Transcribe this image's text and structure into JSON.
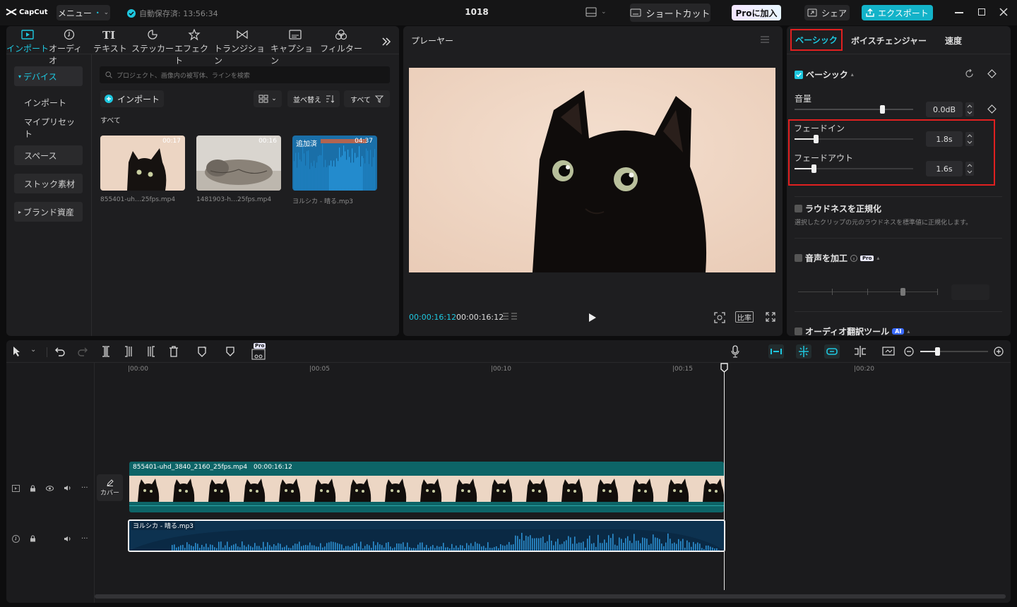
{
  "titlebar": {
    "logo": "CapCut",
    "menu_label": "メニュー",
    "autosave": "自動保存済: 13:56:34",
    "project_name": "1018",
    "shortcut_label": "ショートカット",
    "pro_label": "Proに加入",
    "share_label": "シェア",
    "export_label": "エクスポート"
  },
  "media": {
    "tools": [
      {
        "label": "インポート",
        "icon": "import-icon"
      },
      {
        "label": "オーディオ",
        "icon": "audio-icon"
      },
      {
        "label": "テキスト",
        "icon": "text-icon"
      },
      {
        "label": "ステッカー",
        "icon": "sticker-icon"
      },
      {
        "label": "エフェクト",
        "icon": "effect-icon"
      },
      {
        "label": "トランジション",
        "icon": "transition-icon"
      },
      {
        "label": "キャプション",
        "icon": "caption-icon"
      },
      {
        "label": "フィルター",
        "icon": "filter-icon"
      }
    ],
    "sidebar": [
      "デバイス",
      "インポート",
      "マイプリセット",
      "スペース",
      "ストック素材",
      "ブランド資産"
    ],
    "search_placeholder": "プロジェクト、画像内の被写体、ラインを検索",
    "import_button": "インポート",
    "sort_label": "並べ替え",
    "filter_label": "すべて",
    "section_label": "すべて",
    "items": [
      {
        "name": "855401-uh…25fps.mp4",
        "duration": "00:17",
        "badge": ""
      },
      {
        "name": "1481903-h…25fps.mp4",
        "duration": "00:16",
        "badge": ""
      },
      {
        "name": "ヨルシカ - 晴る.mp3",
        "duration": "04:37",
        "badge": "追加済"
      }
    ]
  },
  "player": {
    "title": "プレーヤー",
    "current_time": "00:00:16:12",
    "total_time": "00:00:16:12",
    "ratio_label": "比率"
  },
  "inspector": {
    "tabs": [
      "ベーシック",
      "ボイスチェンジャー",
      "速度"
    ],
    "basic_section": "ベーシック",
    "volume_label": "音量",
    "volume_value": "0.0dB",
    "volume_level": 0.74,
    "fade_in_label": "フェードイン",
    "fade_in_value": "1.8s",
    "fade_in_level": 0.18,
    "fade_out_label": "フェードアウト",
    "fade_out_value": "1.6s",
    "fade_out_level": 0.16,
    "loudness_label": "ラウドネスを正規化",
    "loudness_desc": "選択したクリップの元のラウドネスを標準値に正規化します。",
    "voice_label": "音声を加工",
    "voice_badge": "Pro",
    "translate_label": "オーディオ翻訳ツール",
    "translate_badge": "AI",
    "highlight_color": "#e02020",
    "accent_color": "#1ec8e0"
  },
  "timeline": {
    "ruler": [
      "|00:00",
      "|00:05",
      "|00:10",
      "|00:15",
      "|00:20"
    ],
    "video_clip_name": "855401-uhd_3840_2160_25fps.mp4",
    "video_clip_duration": "00:00:16:12",
    "audio_clip_name": "ヨルシカ - 晴る.mp3",
    "cover_label": "カバー",
    "pro_badge": "Pro"
  }
}
